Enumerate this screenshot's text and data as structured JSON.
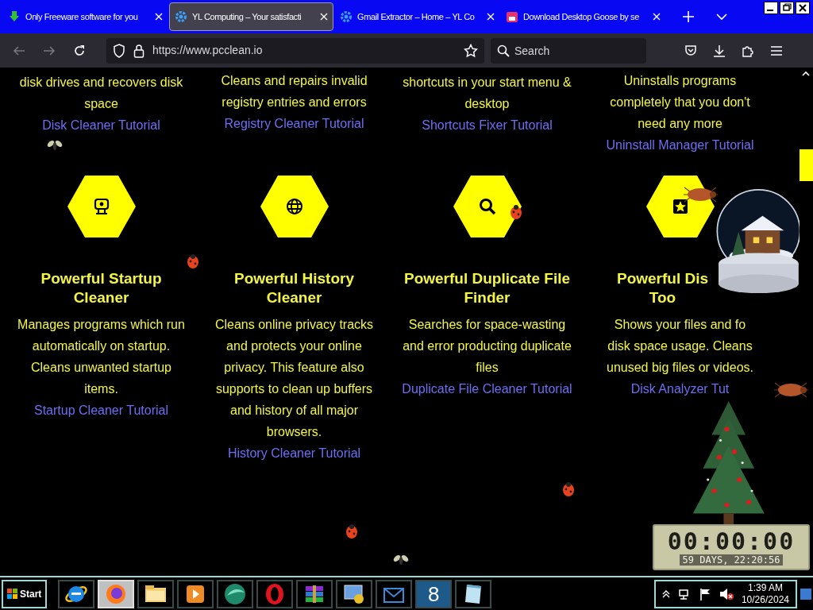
{
  "tabs": [
    {
      "title": "Only Freeware software for you",
      "selected": false
    },
    {
      "title": "YL Computing – Your satisfacti",
      "selected": true
    },
    {
      "title": "Gmail Extractor – Home – YL Co",
      "selected": false
    },
    {
      "title": "Download Desktop Goose by se",
      "selected": false
    }
  ],
  "address_bar": {
    "url": "https://www.pcclean.io"
  },
  "search": {
    "placeholder": "Search"
  },
  "top_cards": [
    {
      "description": [
        "disk drives and recovers disk",
        "space"
      ],
      "link": "Disk Cleaner Tutorial"
    },
    {
      "description": [
        "Cleans and repairs invalid",
        "registry entries and errors"
      ],
      "link": "Registry Cleaner Tutorial"
    },
    {
      "description": [
        "shortcuts in your start menu &",
        "desktop"
      ],
      "link": "Shortcuts Fixer Tutorial"
    },
    {
      "description": [
        "Uninstalls programs",
        "completely that you don't",
        "need any more"
      ],
      "link": "Uninstall Manager Tutorial"
    }
  ],
  "feature_cards": [
    {
      "title": [
        "Powerful Startup",
        "Cleaner"
      ],
      "description": [
        "Manages programs which run",
        "automatically on startup.",
        "Cleans unwanted startup",
        "items."
      ],
      "link": "Startup Cleaner Tutorial"
    },
    {
      "title": [
        "Powerful History",
        "Cleaner"
      ],
      "description": [
        "Cleans online privacy tracks",
        "and protects your online",
        "privacy. This feature also",
        "supports to clean up buffers",
        "and history of all major",
        "browsers."
      ],
      "link": "History Cleaner Tutorial"
    },
    {
      "title": [
        "Powerful Duplicate File",
        "Finder"
      ],
      "description": [
        "Searches for space-wasting",
        "and error producting duplicate",
        "files"
      ],
      "link": "Duplicate File Cleaner Tutorial"
    },
    {
      "title": [
        "Powerful Dis",
        "Too"
      ],
      "description": [
        "Shows your files and fo",
        "disk space usage. Cleans",
        "unused big files or videos."
      ],
      "link": "Disk Analyzer Tut"
    }
  ],
  "countdown": {
    "time": "00:00:00",
    "remaining": "59 DAYS, 22:20:56"
  },
  "taskbar": {
    "start": "Start",
    "apps": [
      {
        "selected": false
      },
      {
        "selected": true
      },
      {
        "selected": false
      },
      {
        "selected": false
      },
      {
        "selected": false
      },
      {
        "selected": false
      },
      {
        "selected": false
      },
      {
        "selected": false
      },
      {
        "selected": false
      },
      {
        "selected": false,
        "glyph": "8"
      },
      {
        "selected": false
      }
    ],
    "clock": {
      "time": "1:39 AM",
      "date": "10/26/2024"
    }
  }
}
